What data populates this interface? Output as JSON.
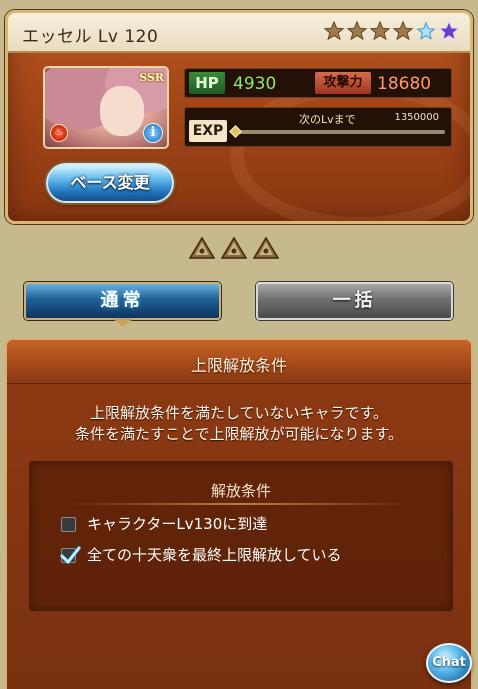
{
  "character": {
    "name": "エッセル",
    "level_text": "Lv 120",
    "rarity": "SSR",
    "element_icon": "fire-icon",
    "stars_filled": 4,
    "stars_extra": 1,
    "stars_total": 6
  },
  "stats": {
    "hp_label": "HP",
    "hp_value": "4930",
    "atk_label": "攻撃力",
    "atk_value": "18680",
    "exp_label": "EXP",
    "exp_next_text": "次のLvまで",
    "exp_next_value": "1350000",
    "exp_progress": 0.0
  },
  "buttons": {
    "base_change": "ベース変更",
    "tab_normal": "通常",
    "tab_bulk": "一括",
    "chat": "Chat"
  },
  "uncap_count": 3,
  "conditions": {
    "title": "上限解放条件",
    "description_line1": "上限解放条件を満たしていないキャラです。",
    "description_line2": "条件を満たすことで上限解放が可能になります。",
    "box_title": "解放条件",
    "items": [
      {
        "text": "キャラクターLv130に到達",
        "checked": false
      },
      {
        "text": "全ての十天衆を最終上限解放している",
        "checked": true
      }
    ]
  },
  "colors": {
    "panel_brown": "#9c4116",
    "hp_green": "#8ee96a",
    "atk_orange": "#ff9a6c",
    "tab_blue": "#1d5f97"
  }
}
